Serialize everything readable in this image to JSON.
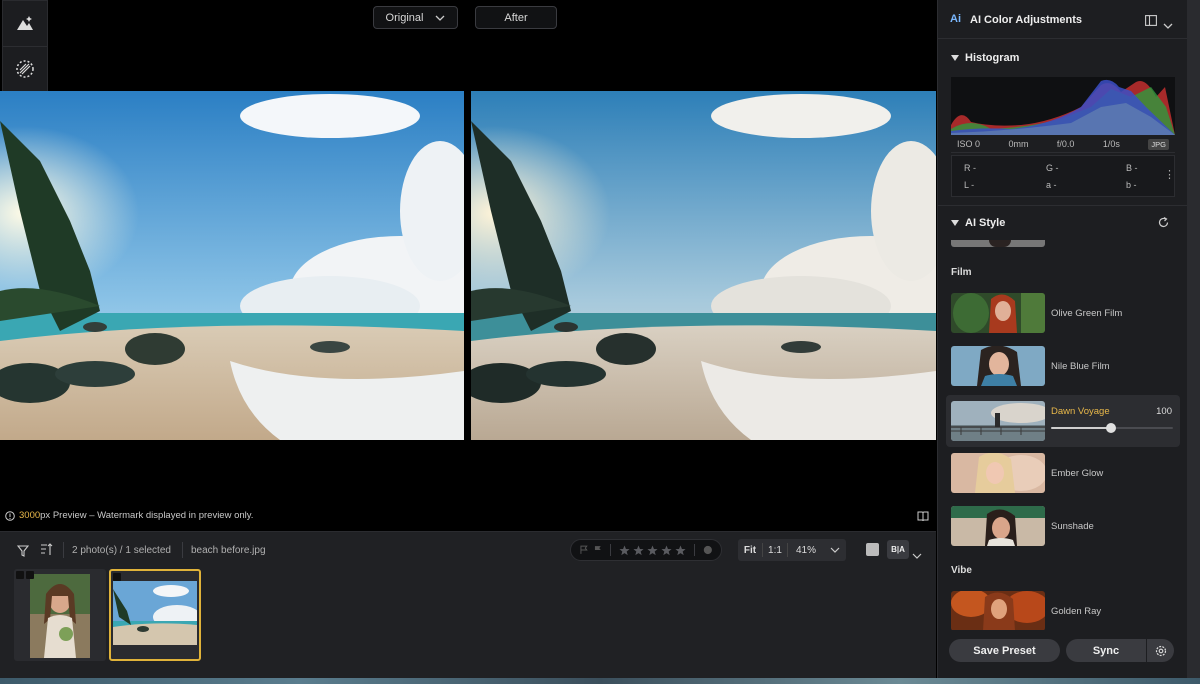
{
  "compare": {
    "original_label": "Original",
    "after_label": "After"
  },
  "preview_note": {
    "px_value": "3000",
    "text": "px Preview – Watermark displayed in preview only."
  },
  "bottom_bar": {
    "selection": "2 photo(s) / 1 selected",
    "filename": "beach before.jpg",
    "rating_stars": 0,
    "fit_label": "Fit",
    "one_to_one_label": "1:1",
    "zoom": "41%",
    "compare_mode_label": "B|A"
  },
  "panel": {
    "title": "AI Color Adjustments",
    "ai_badge": "Ai",
    "histogram": {
      "title": "Histogram",
      "iso": "ISO 0",
      "focal": "0mm",
      "aperture": "f/0.0",
      "shutter": "1/0s",
      "format": "JPG",
      "r": "R -",
      "g": "G -",
      "b": "B -",
      "l": "L -",
      "a": "a -",
      "bb": "b -"
    },
    "ai_style": {
      "title": "AI Style",
      "groups": [
        {
          "name": "Film",
          "items": [
            {
              "label": "Olive Green Film"
            },
            {
              "label": "Nile Blue Film"
            },
            {
              "label": "Dawn Voyage",
              "value": "100",
              "selected": true,
              "amount": 1.0
            },
            {
              "label": "Ember Glow"
            },
            {
              "label": "Sunshade"
            }
          ]
        },
        {
          "name": "Vibe",
          "items": [
            {
              "label": "Golden Ray"
            }
          ]
        }
      ]
    },
    "save_preset_label": "Save Preset",
    "sync_label": "Sync"
  },
  "colors": {
    "accent": "#e8b84a",
    "panel_bg": "#1d1e21",
    "selected_border": "#e0b33a"
  }
}
